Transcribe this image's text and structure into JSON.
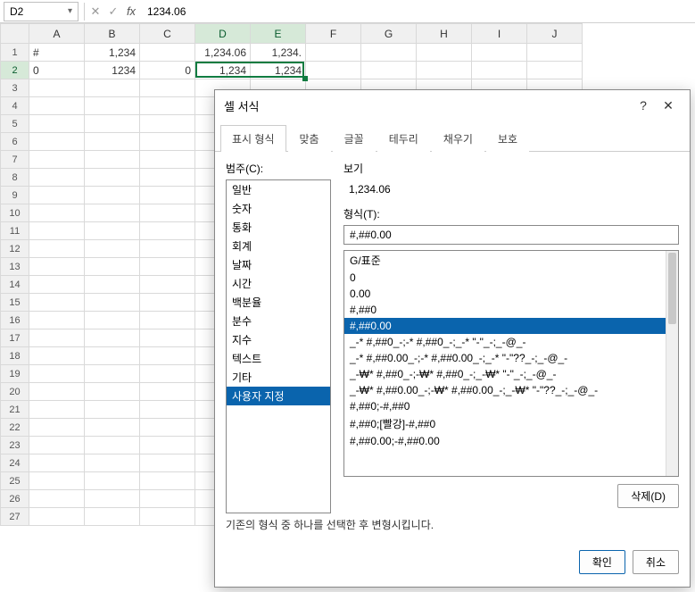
{
  "namebox": "D2",
  "formula": "1234.06",
  "columns": [
    "A",
    "B",
    "C",
    "D",
    "E",
    "F",
    "G",
    "H",
    "I",
    "J"
  ],
  "rows_visible": 27,
  "cells": {
    "A1": "#",
    "A2": "0",
    "B1": "1,234",
    "B2": "1234",
    "C2": "0",
    "D1": "1,234.06",
    "D2": "1,234",
    "E1": "1,234.",
    "E2": "1,234"
  },
  "left_aligned": [
    "A1",
    "A2"
  ],
  "selection_shaded": [
    "E2"
  ],
  "selection_active": "D2",
  "dialog": {
    "title": "셀 서식",
    "help": "?",
    "close": "✕",
    "tabs": [
      "표시 형식",
      "맞춤",
      "글꼴",
      "테두리",
      "채우기",
      "보호"
    ],
    "active_tab": 0,
    "category_label": "범주(C):",
    "categories": [
      "일반",
      "숫자",
      "통화",
      "회계",
      "날짜",
      "시간",
      "백분율",
      "분수",
      "지수",
      "텍스트",
      "기타",
      "사용자 지정"
    ],
    "category_selected": 11,
    "preview_label": "보기",
    "preview_value": "1,234.06",
    "format_label": "형식(T):",
    "format_value": "#,##0.00",
    "format_list": [
      "G/표준",
      "0",
      "0.00",
      "#,##0",
      "#,##0.00",
      "_-* #,##0_-;-* #,##0_-;_-* \"-\"_-;_-@_-",
      "_-* #,##0.00_-;-* #,##0.00_-;_-* \"-\"??_-;_-@_-",
      "_-₩* #,##0_-;-₩* #,##0_-;_-₩* \"-\"_-;_-@_-",
      "_-₩* #,##0.00_-;-₩* #,##0.00_-;_-₩* \"-\"??_-;_-@_-",
      "#,##0;-#,##0",
      "#,##0;[빨강]-#,##0",
      "#,##0.00;-#,##0.00"
    ],
    "format_selected": 4,
    "delete_btn": "삭제(D)",
    "hint": "기존의 형식 중 하나를 선택한 후 변형시킵니다.",
    "ok": "확인",
    "cancel": "취소"
  }
}
